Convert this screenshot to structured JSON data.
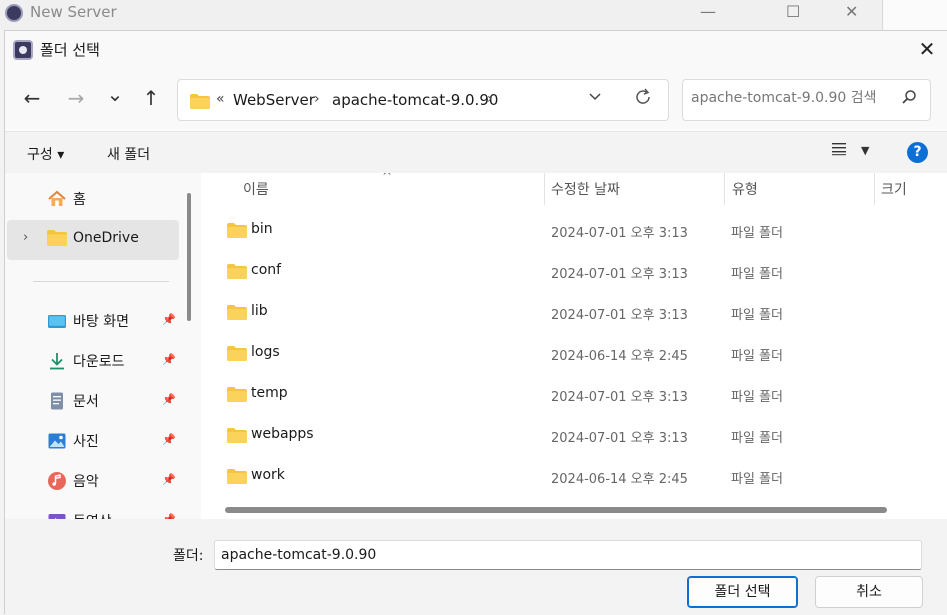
{
  "background_window": {
    "title": "New Server",
    "minimize": "—",
    "maximize": "☐",
    "close": "✕"
  },
  "dialog": {
    "title": "폴더 선택",
    "close": "✕"
  },
  "nav": {
    "back": "←",
    "forward": "→",
    "recent": "⌄",
    "up": "↑"
  },
  "address": {
    "overflow": "«",
    "crumbs": [
      "WebServer",
      "apache-tomcat-9.0.90"
    ],
    "separator": "›"
  },
  "search": {
    "placeholder": "apache-tomcat-9.0.90 검색"
  },
  "toolbar": {
    "organize": "구성 ▾",
    "new_folder": "새 폴더",
    "help": "?"
  },
  "sidebar": {
    "items": [
      {
        "label": "홈",
        "icon": "home-icon"
      },
      {
        "label": "OneDrive",
        "icon": "folder-icon"
      },
      {
        "label": "바탕 화면",
        "icon": "desktop-icon",
        "pinned": true
      },
      {
        "label": "다운로드",
        "icon": "download-icon",
        "pinned": true
      },
      {
        "label": "문서",
        "icon": "document-icon",
        "pinned": true
      },
      {
        "label": "사진",
        "icon": "picture-icon",
        "pinned": true
      },
      {
        "label": "음악",
        "icon": "music-icon",
        "pinned": true
      },
      {
        "label": "동영상",
        "icon": "video-icon",
        "pinned": true
      }
    ]
  },
  "columns": {
    "name": "이름",
    "modified": "수정한 날짜",
    "type": "유형",
    "size": "크기"
  },
  "files": [
    {
      "name": "bin",
      "modified": "2024-07-01 오후 3:13",
      "type": "파일 폴더"
    },
    {
      "name": "conf",
      "modified": "2024-07-01 오후 3:13",
      "type": "파일 폴더"
    },
    {
      "name": "lib",
      "modified": "2024-07-01 오후 3:13",
      "type": "파일 폴더"
    },
    {
      "name": "logs",
      "modified": "2024-06-14 오후 2:45",
      "type": "파일 폴더"
    },
    {
      "name": "temp",
      "modified": "2024-07-01 오후 3:13",
      "type": "파일 폴더"
    },
    {
      "name": "webapps",
      "modified": "2024-07-01 오후 3:13",
      "type": "파일 폴더"
    },
    {
      "name": "work",
      "modified": "2024-06-14 오후 2:45",
      "type": "파일 폴더"
    }
  ],
  "footer": {
    "folder_label": "폴더:",
    "folder_value": "apache-tomcat-9.0.90",
    "select_button": "폴더 선택",
    "cancel_button": "취소"
  },
  "colors": {
    "accent": "#0c6fd6",
    "folder": "#f5c542",
    "selected_nav": "#e5e5e5"
  }
}
